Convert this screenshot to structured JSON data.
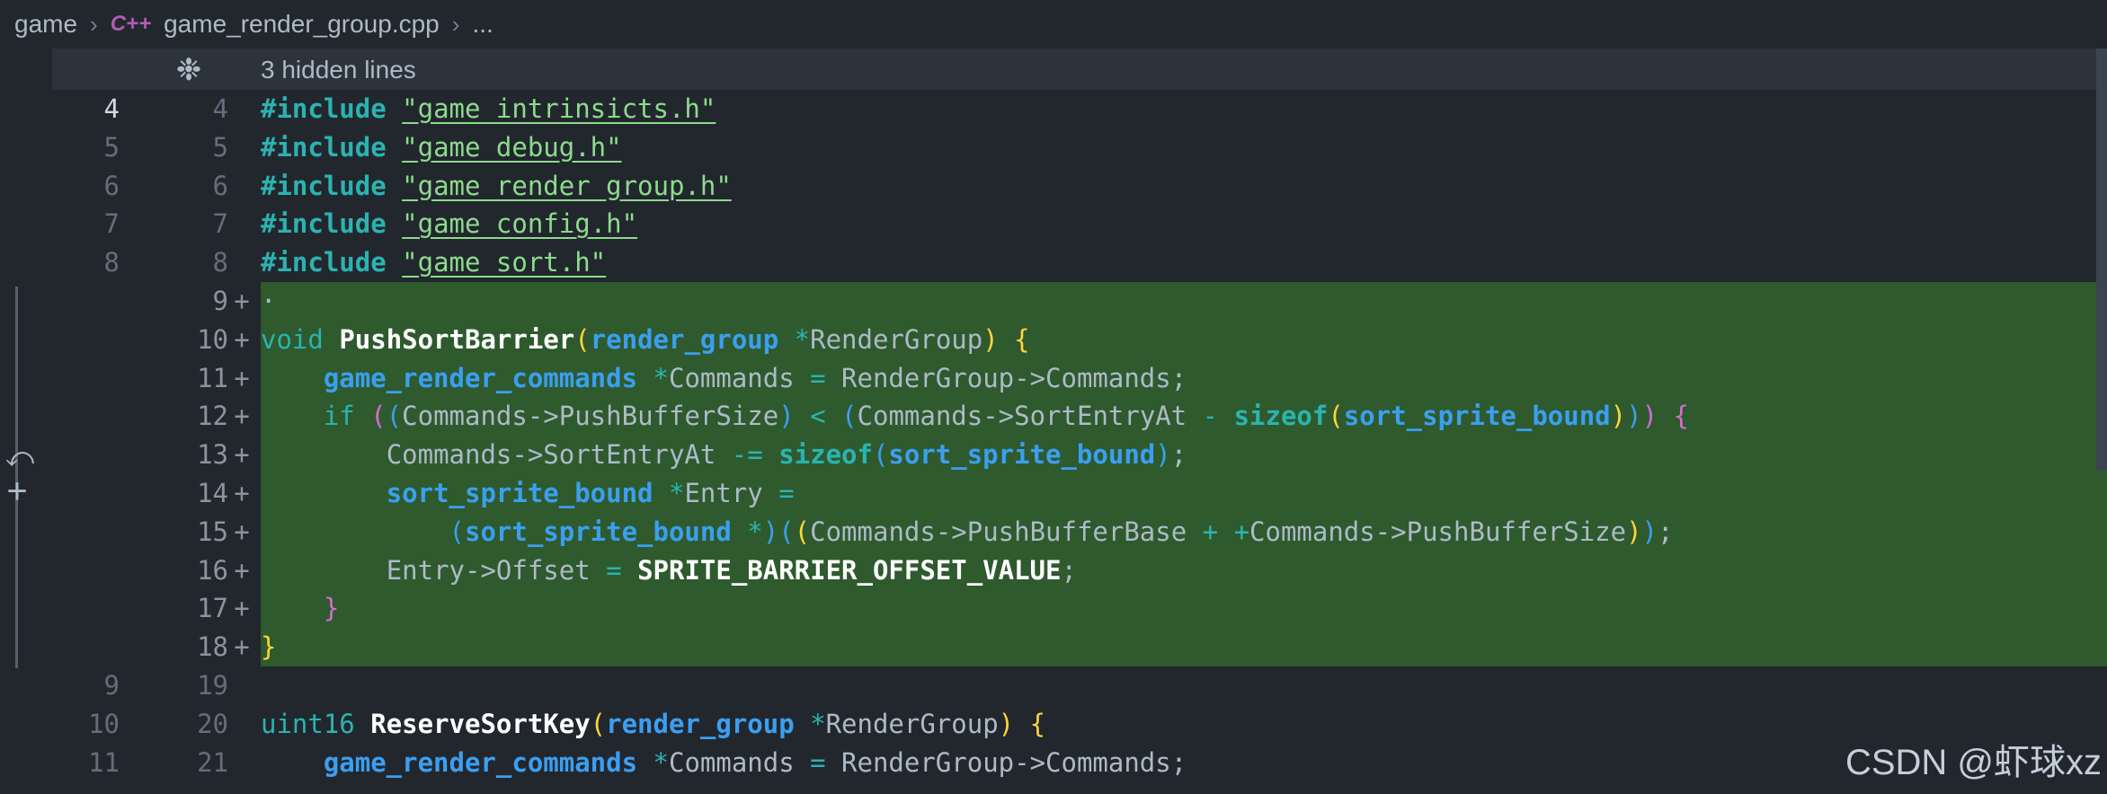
{
  "breadcrumb": {
    "folder": "game",
    "file_icon": "C++",
    "file": "game_render_group.cpp",
    "more": "..."
  },
  "hidden": {
    "label": "3 hidden lines"
  },
  "lines": [
    {
      "old": "4",
      "new": "4",
      "added": false,
      "tokens": [
        {
          "t": "#include",
          "c": "kw"
        },
        {
          "t": " ",
          "c": "plain"
        },
        {
          "t": "\"game_intrinsicts.h\"",
          "c": "str"
        }
      ]
    },
    {
      "old": "5",
      "new": "5",
      "added": false,
      "tokens": [
        {
          "t": "#include",
          "c": "kw"
        },
        {
          "t": " ",
          "c": "plain"
        },
        {
          "t": "\"game_debug.h\"",
          "c": "str"
        }
      ]
    },
    {
      "old": "6",
      "new": "6",
      "added": false,
      "tokens": [
        {
          "t": "#include",
          "c": "kw"
        },
        {
          "t": " ",
          "c": "plain"
        },
        {
          "t": "\"game_render_group.h\"",
          "c": "str"
        }
      ]
    },
    {
      "old": "7",
      "new": "7",
      "added": false,
      "tokens": [
        {
          "t": "#include",
          "c": "kw"
        },
        {
          "t": " ",
          "c": "plain"
        },
        {
          "t": "\"game_config.h\"",
          "c": "str"
        }
      ]
    },
    {
      "old": "8",
      "new": "8",
      "added": false,
      "tokens": [
        {
          "t": "#include",
          "c": "kw"
        },
        {
          "t": " ",
          "c": "plain"
        },
        {
          "t": "\"game_sort.h\"",
          "c": "str"
        }
      ]
    },
    {
      "old": "",
      "new": "9",
      "added": true,
      "tokens": [
        {
          "t": "·",
          "c": "plain"
        }
      ]
    },
    {
      "old": "",
      "new": "10",
      "added": true,
      "tokens": [
        {
          "t": "void",
          "c": "kw2"
        },
        {
          "t": " ",
          "c": "plain"
        },
        {
          "t": "PushSortBarrier",
          "c": "fn"
        },
        {
          "t": "(",
          "c": "p1"
        },
        {
          "t": "render_group",
          "c": "type"
        },
        {
          "t": " ",
          "c": "plain"
        },
        {
          "t": "*",
          "c": "op"
        },
        {
          "t": "RenderGroup",
          "c": "plain"
        },
        {
          "t": ")",
          "c": "p1"
        },
        {
          "t": " ",
          "c": "plain"
        },
        {
          "t": "{",
          "c": "p1"
        }
      ]
    },
    {
      "old": "",
      "new": "11",
      "added": true,
      "tokens": [
        {
          "t": "    ",
          "c": "plain"
        },
        {
          "t": "game_render_commands",
          "c": "type"
        },
        {
          "t": " ",
          "c": "plain"
        },
        {
          "t": "*",
          "c": "op"
        },
        {
          "t": "Commands ",
          "c": "plain"
        },
        {
          "t": "=",
          "c": "op"
        },
        {
          "t": " RenderGroup->Commands;",
          "c": "plain"
        }
      ]
    },
    {
      "old": "",
      "new": "12",
      "added": true,
      "tokens": [
        {
          "t": "    ",
          "c": "plain"
        },
        {
          "t": "if",
          "c": "kw2"
        },
        {
          "t": " ",
          "c": "plain"
        },
        {
          "t": "(",
          "c": "p2"
        },
        {
          "t": "(",
          "c": "p3"
        },
        {
          "t": "Commands->PushBufferSize",
          "c": "plain"
        },
        {
          "t": ")",
          "c": "p3"
        },
        {
          "t": " ",
          "c": "plain"
        },
        {
          "t": "<",
          "c": "op"
        },
        {
          "t": " ",
          "c": "plain"
        },
        {
          "t": "(",
          "c": "p3"
        },
        {
          "t": "Commands->SortEntryAt ",
          "c": "plain"
        },
        {
          "t": "-",
          "c": "op"
        },
        {
          "t": " ",
          "c": "plain"
        },
        {
          "t": "sizeof",
          "c": "kw"
        },
        {
          "t": "(",
          "c": "p1"
        },
        {
          "t": "sort_sprite_bound",
          "c": "type"
        },
        {
          "t": ")",
          "c": "p1"
        },
        {
          "t": ")",
          "c": "p3"
        },
        {
          "t": ")",
          "c": "p2"
        },
        {
          "t": " ",
          "c": "plain"
        },
        {
          "t": "{",
          "c": "p2"
        }
      ]
    },
    {
      "old": "",
      "new": "13",
      "added": true,
      "tokens": [
        {
          "t": "        ",
          "c": "plain"
        },
        {
          "t": "Commands->SortEntryAt ",
          "c": "plain"
        },
        {
          "t": "-=",
          "c": "op"
        },
        {
          "t": " ",
          "c": "plain"
        },
        {
          "t": "sizeof",
          "c": "kw"
        },
        {
          "t": "(",
          "c": "p3"
        },
        {
          "t": "sort_sprite_bound",
          "c": "type"
        },
        {
          "t": ")",
          "c": "p3"
        },
        {
          "t": ";",
          "c": "plain"
        }
      ]
    },
    {
      "old": "",
      "new": "14",
      "added": true,
      "tokens": [
        {
          "t": "        ",
          "c": "plain"
        },
        {
          "t": "sort_sprite_bound",
          "c": "type"
        },
        {
          "t": " ",
          "c": "plain"
        },
        {
          "t": "*",
          "c": "op"
        },
        {
          "t": "Entry ",
          "c": "plain"
        },
        {
          "t": "=",
          "c": "op"
        }
      ]
    },
    {
      "old": "",
      "new": "15",
      "added": true,
      "tokens": [
        {
          "t": "            ",
          "c": "plain"
        },
        {
          "t": "(",
          "c": "p3"
        },
        {
          "t": "sort_sprite_bound",
          "c": "type"
        },
        {
          "t": " ",
          "c": "plain"
        },
        {
          "t": "*",
          "c": "op"
        },
        {
          "t": ")",
          "c": "p3"
        },
        {
          "t": "(",
          "c": "p3"
        },
        {
          "t": "(",
          "c": "p1"
        },
        {
          "t": "Commands->PushBufferBase ",
          "c": "plain"
        },
        {
          "t": "+",
          "c": "op"
        },
        {
          "t": " ",
          "c": "plain"
        },
        {
          "t": "+",
          "c": "op"
        },
        {
          "t": "Commands->PushBufferSize",
          "c": "plain"
        },
        {
          "t": ")",
          "c": "p1"
        },
        {
          "t": ")",
          "c": "p3"
        },
        {
          "t": ";",
          "c": "plain"
        }
      ]
    },
    {
      "old": "",
      "new": "16",
      "added": true,
      "tokens": [
        {
          "t": "        ",
          "c": "plain"
        },
        {
          "t": "Entry->Offset ",
          "c": "plain"
        },
        {
          "t": "=",
          "c": "op"
        },
        {
          "t": " ",
          "c": "plain"
        },
        {
          "t": "SPRITE_BARRIER_OFFSET_VALUE",
          "c": "const"
        },
        {
          "t": ";",
          "c": "plain"
        }
      ]
    },
    {
      "old": "",
      "new": "17",
      "added": true,
      "tokens": [
        {
          "t": "    ",
          "c": "plain"
        },
        {
          "t": "}",
          "c": "p2"
        }
      ]
    },
    {
      "old": "",
      "new": "18",
      "added": true,
      "tokens": [
        {
          "t": "}",
          "c": "p1"
        }
      ]
    },
    {
      "old": "9",
      "new": "19",
      "added": false,
      "tokens": []
    },
    {
      "old": "10",
      "new": "20",
      "added": false,
      "tokens": [
        {
          "t": "uint16",
          "c": "kw2"
        },
        {
          "t": " ",
          "c": "plain"
        },
        {
          "t": "ReserveSortKey",
          "c": "fn"
        },
        {
          "t": "(",
          "c": "p1"
        },
        {
          "t": "render_group",
          "c": "type"
        },
        {
          "t": " ",
          "c": "plain"
        },
        {
          "t": "*",
          "c": "op"
        },
        {
          "t": "RenderGroup",
          "c": "plain"
        },
        {
          "t": ")",
          "c": "p1"
        },
        {
          "t": " ",
          "c": "plain"
        },
        {
          "t": "{",
          "c": "p1"
        }
      ]
    },
    {
      "old": "11",
      "new": "21",
      "added": false,
      "tokens": [
        {
          "t": "    ",
          "c": "plain"
        },
        {
          "t": "game_render_commands",
          "c": "type"
        },
        {
          "t": " ",
          "c": "plain"
        },
        {
          "t": "*",
          "c": "op"
        },
        {
          "t": "Commands ",
          "c": "plain"
        },
        {
          "t": "=",
          "c": "op"
        },
        {
          "t": " RenderGroup->Commands;",
          "c": "plain"
        }
      ]
    }
  ],
  "added_marker": "+",
  "current_old_line": "4",
  "current_new_line": "9",
  "colors": {
    "background": "#22272e",
    "added_background": "#2e5a2e",
    "keyword": "#2bb3b0",
    "string": "#8ddb8c",
    "type": "#3b9ff0"
  },
  "icons": {
    "file_type": "cpp-icon",
    "expand": "unfold-icon",
    "revert": "revert-icon",
    "add": "add-icon"
  },
  "watermark": "CSDN @虾球xz"
}
